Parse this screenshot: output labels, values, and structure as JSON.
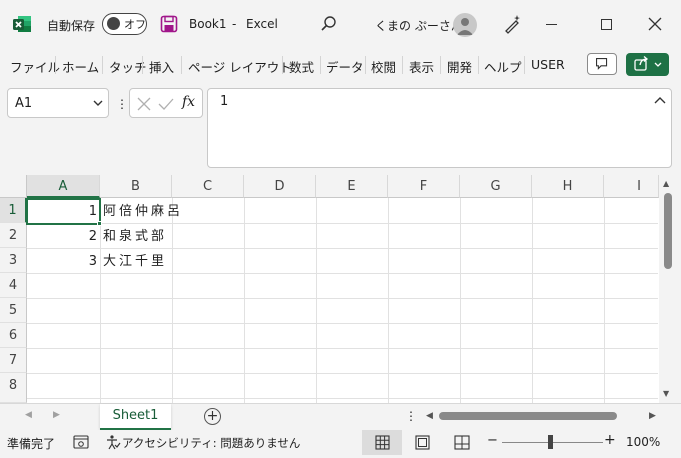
{
  "titlebar": {
    "autosave_label": "自動保存",
    "autosave_state": "オフ",
    "document_name": "Book1",
    "separator": "-",
    "app_name": "Excel",
    "user_name": "くまの ぷーさん"
  },
  "menu": {
    "items": [
      "ファイル",
      "ホーム",
      "タッチ",
      "挿入",
      "ページ レイアウト",
      "数式",
      "データ",
      "校閲",
      "表示",
      "開発",
      "ヘルプ",
      "USER"
    ]
  },
  "formula_bar": {
    "name_box": "A1",
    "dots": "⋮",
    "fx_label": "fx",
    "content": "1"
  },
  "grid": {
    "columns": [
      "A",
      "B",
      "C",
      "D",
      "E",
      "F",
      "G",
      "H",
      "I"
    ],
    "selected_column": "A",
    "rows": [
      "1",
      "2",
      "3",
      "4",
      "5",
      "6",
      "7",
      "8"
    ],
    "selected_row": "1",
    "cells": {
      "A1": "1",
      "B1": "阿倍仲麻呂",
      "A2": "2",
      "B2": "和泉式部",
      "A3": "3",
      "B3": "大江千里"
    }
  },
  "sheets": {
    "tabs": [
      "Sheet1"
    ],
    "active": "Sheet1",
    "add_label": "+"
  },
  "statusbar": {
    "ready": "準備完了",
    "accessibility": "アクセシビリティ: 問題ありません",
    "zoom": "100%",
    "zoom_minus": "−",
    "zoom_plus": "+",
    "active_view": "normal"
  },
  "colors": {
    "accent": "#217346",
    "accent_dark": "#185c37",
    "share_button": "#1e7145"
  }
}
